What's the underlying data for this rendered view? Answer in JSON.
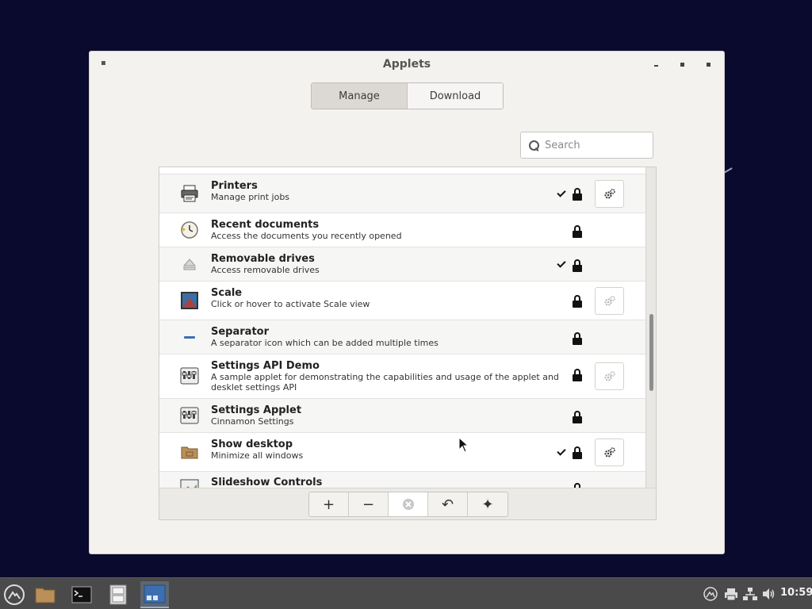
{
  "window": {
    "title": "Applets",
    "controls": [
      "minimize",
      "maximize",
      "close"
    ]
  },
  "tabs": [
    {
      "label": "Manage",
      "active": true
    },
    {
      "label": "Download",
      "active": false
    }
  ],
  "search": {
    "placeholder": "Search",
    "value": ""
  },
  "applets": [
    {
      "name": "Printers",
      "description": "Manage print jobs",
      "icon": "printer-icon",
      "enabled": true,
      "locked": true,
      "configurable": true,
      "configure_dim": false
    },
    {
      "name": "Recent documents",
      "description": "Access the documents you recently opened",
      "icon": "clock-icon",
      "enabled": false,
      "locked": true,
      "configurable": false
    },
    {
      "name": "Removable drives",
      "description": "Access removable drives",
      "icon": "eject-icon",
      "enabled": true,
      "locked": true,
      "configurable": false
    },
    {
      "name": "Scale",
      "description": "Click or hover to activate Scale view",
      "icon": "scale-icon",
      "enabled": false,
      "locked": true,
      "configurable": true,
      "configure_dim": true
    },
    {
      "name": "Separator",
      "description": "A separator icon which can be added multiple times",
      "icon": "separator-icon",
      "enabled": false,
      "locked": true,
      "configurable": false
    },
    {
      "name": "Settings API Demo",
      "description": "A sample applet for demonstrating the capabilities and usage of the applet and desklet settings API",
      "icon": "settings-icon",
      "enabled": false,
      "locked": true,
      "configurable": true,
      "configure_dim": true
    },
    {
      "name": "Settings Applet",
      "description": "Cinnamon Settings",
      "icon": "settings-icon",
      "enabled": false,
      "locked": true,
      "configurable": false
    },
    {
      "name": "Show desktop",
      "description": "Minimize all windows",
      "icon": "folder-icon",
      "enabled": true,
      "locked": true,
      "configurable": true,
      "configure_dim": false
    },
    {
      "name": "Slideshow Controls",
      "description": "",
      "icon": "slideshow-icon",
      "enabled": false,
      "locked": true,
      "configurable": false
    }
  ],
  "toolbar": {
    "add": "+",
    "remove": "−",
    "restore": "↶",
    "more": "✦"
  },
  "taskbar": {
    "clock": "10:59",
    "items": [
      "menu-icon",
      "files-icon",
      "terminal-icon",
      "file-cabinet-icon",
      "applets-window-icon"
    ],
    "tray": [
      "cinnamon-icon",
      "printer-icon",
      "network-icon",
      "volume-icon"
    ]
  }
}
